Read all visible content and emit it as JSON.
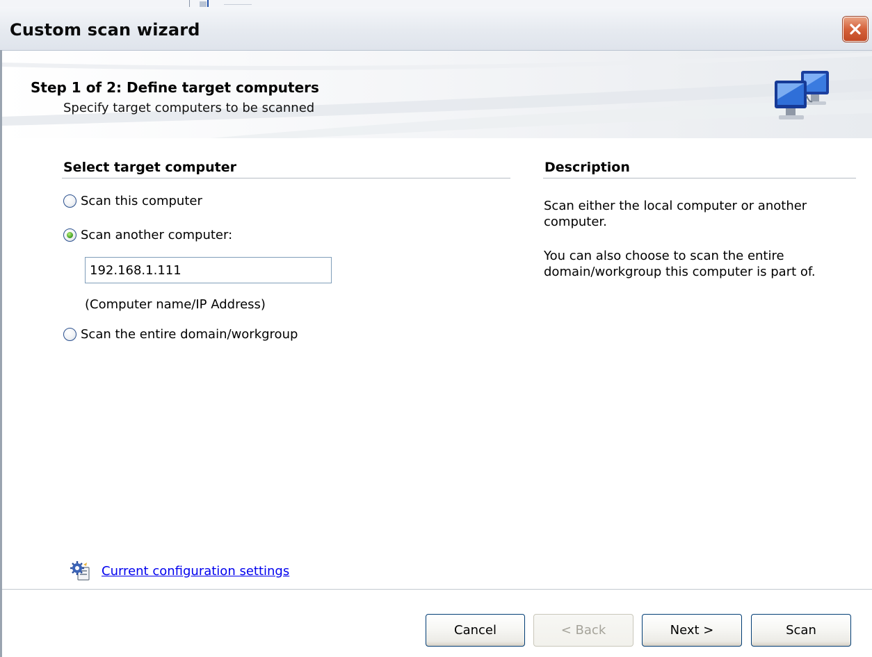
{
  "window": {
    "title": "Custom scan wizard",
    "close_icon": "close-icon",
    "close_color": "#d5613a"
  },
  "header": {
    "step_title": "Step 1 of 2: Define target computers",
    "step_subtitle": "Specify target computers to be scanned",
    "graphic_icon": "network-computers-icon"
  },
  "target": {
    "heading": "Select target computer",
    "options": [
      {
        "label": "Scan this computer",
        "selected": false
      },
      {
        "label": "Scan another computer:",
        "selected": true
      },
      {
        "label": "Scan the entire domain/workgroup",
        "selected": false
      }
    ],
    "computer_input_value": "192.168.1.111",
    "computer_input_hint": "(Computer name/IP Address)"
  },
  "description": {
    "heading": "Description",
    "paragraphs": [
      "Scan either the local computer or another computer.",
      "You can also choose to scan the entire domain/workgroup this computer is part of."
    ]
  },
  "config_link": {
    "label": "Current configuration settings",
    "icon": "settings-icon"
  },
  "buttons": {
    "cancel": "Cancel",
    "back": "< Back",
    "back_enabled": false,
    "next": "Next >",
    "scan": "Scan"
  }
}
